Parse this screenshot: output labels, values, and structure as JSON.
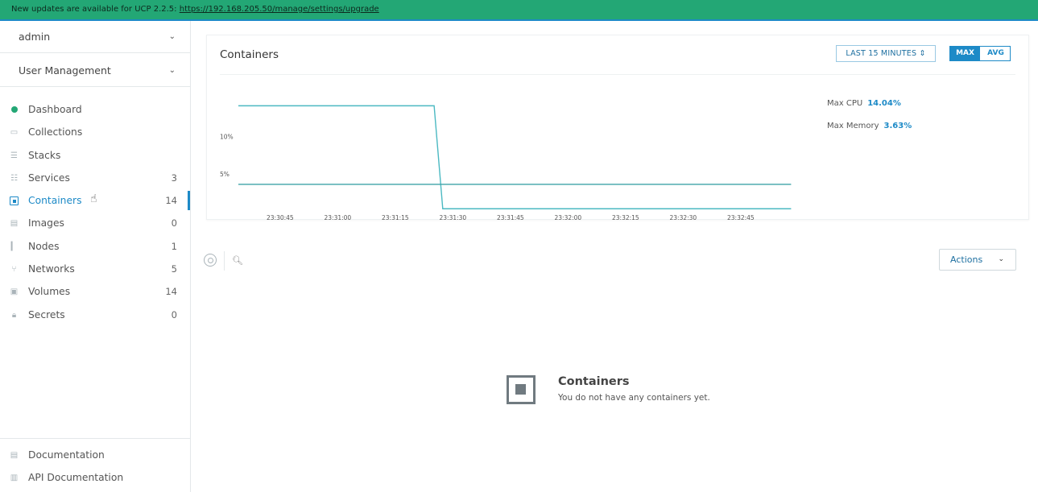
{
  "banner": {
    "text": "New updates are available for UCP 2.2.5:",
    "link": "https://192.168.205.50/manage/settings/upgrade"
  },
  "sidebar": {
    "user_select": "admin",
    "org_select": "User Management",
    "items": [
      {
        "label": "Dashboard",
        "count": "",
        "icon": "dashboard-dot-icon"
      },
      {
        "label": "Collections",
        "count": "",
        "icon": "collections-icon"
      },
      {
        "label": "Stacks",
        "count": "",
        "icon": "stacks-icon"
      },
      {
        "label": "Services",
        "count": "3",
        "icon": "services-icon"
      },
      {
        "label": "Containers",
        "count": "14",
        "icon": "container-icon"
      },
      {
        "label": "Images",
        "count": "0",
        "icon": "image-icon"
      },
      {
        "label": "Nodes",
        "count": "1",
        "icon": "node-icon"
      },
      {
        "label": "Networks",
        "count": "5",
        "icon": "network-icon"
      },
      {
        "label": "Volumes",
        "count": "14",
        "icon": "volume-icon"
      },
      {
        "label": "Secrets",
        "count": "0",
        "icon": "lock-icon"
      }
    ],
    "bottom": [
      {
        "label": "Documentation",
        "icon": "document-icon"
      },
      {
        "label": "API Documentation",
        "icon": "api-document-icon"
      }
    ]
  },
  "panel": {
    "title": "Containers",
    "range": "LAST 15 MINUTES",
    "mode_max": "MAX",
    "mode_avg": "AVG"
  },
  "metrics": {
    "cpu_label": "Max CPU",
    "cpu_value": "14.04%",
    "mem_label": "Max Memory",
    "mem_value": "3.63%"
  },
  "chart_data": {
    "type": "line",
    "x": [
      "23:30:45",
      "23:31:00",
      "23:31:15",
      "23:31:30",
      "23:31:45",
      "23:32:00",
      "23:32:15",
      "23:32:30",
      "23:32:45"
    ],
    "y_ticks": [
      "5%",
      "10%"
    ],
    "series": [
      {
        "name": "Max CPU",
        "color": "#4bb9c2",
        "points": [
          [
            0,
            14.04
          ],
          [
            3.4,
            14.04
          ],
          [
            3.55,
            0.4
          ],
          [
            9.6,
            0.4
          ]
        ]
      },
      {
        "name": "Max Memory",
        "color": "#3fa3a8",
        "points": [
          [
            0,
            3.63
          ],
          [
            9.6,
            3.63
          ]
        ]
      }
    ],
    "ylim": [
      0,
      16
    ],
    "grid": false
  },
  "toolbar": {
    "actions_label": "Actions"
  },
  "empty_state": {
    "title": "Containers",
    "message": "You do not have any containers yet."
  }
}
